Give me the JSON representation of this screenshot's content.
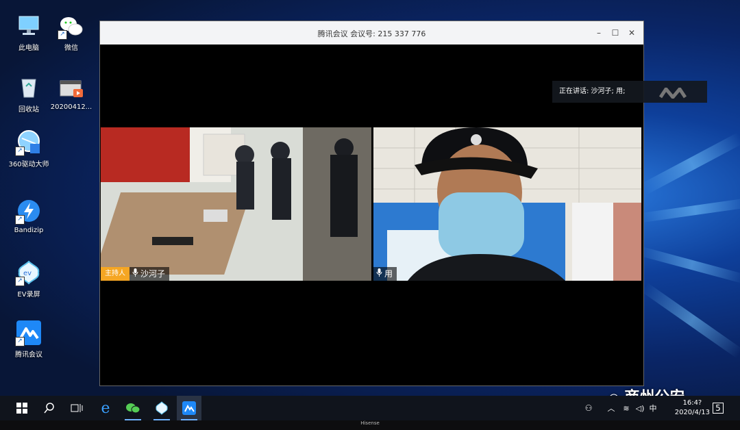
{
  "desktop": {
    "icons": [
      {
        "label": "此电脑",
        "icon": "computer-icon"
      },
      {
        "label": "微信",
        "icon": "wechat-icon"
      },
      {
        "label": "回收站",
        "icon": "recycle-bin-icon"
      },
      {
        "label": "20200412...",
        "icon": "video-file-icon"
      },
      {
        "label": "360驱动大师",
        "icon": "360-driver-icon"
      },
      {
        "label": "Bandizip",
        "icon": "bandizip-icon"
      },
      {
        "label": "EV录屏",
        "icon": "ev-recorder-icon"
      },
      {
        "label": "腾讯会议",
        "icon": "tencent-meeting-icon"
      }
    ]
  },
  "meeting_window": {
    "title": "腾讯会议  会议号: 215 337 776",
    "controls": [
      "minimize",
      "maximize",
      "close"
    ],
    "speaking_label": "正在讲话: 沙河子; 用;",
    "participants": [
      {
        "name": "沙河子",
        "host_badge": "主持人",
        "icon": "microphone-icon"
      },
      {
        "name": "用",
        "icon": "microphone-icon"
      }
    ]
  },
  "taskbar": {
    "items": [
      "windows-start-icon",
      "search-icon",
      "task-view-icon",
      "edge-icon",
      "wechat-icon",
      "360-driver-icon",
      "tencent-meeting-icon"
    ],
    "tray_input": "中",
    "clock_time": "16:4?",
    "clock_date": "2020/4/13",
    "notification_count": "5"
  },
  "watermark": "商州公安",
  "tv_brand": "Hisense"
}
